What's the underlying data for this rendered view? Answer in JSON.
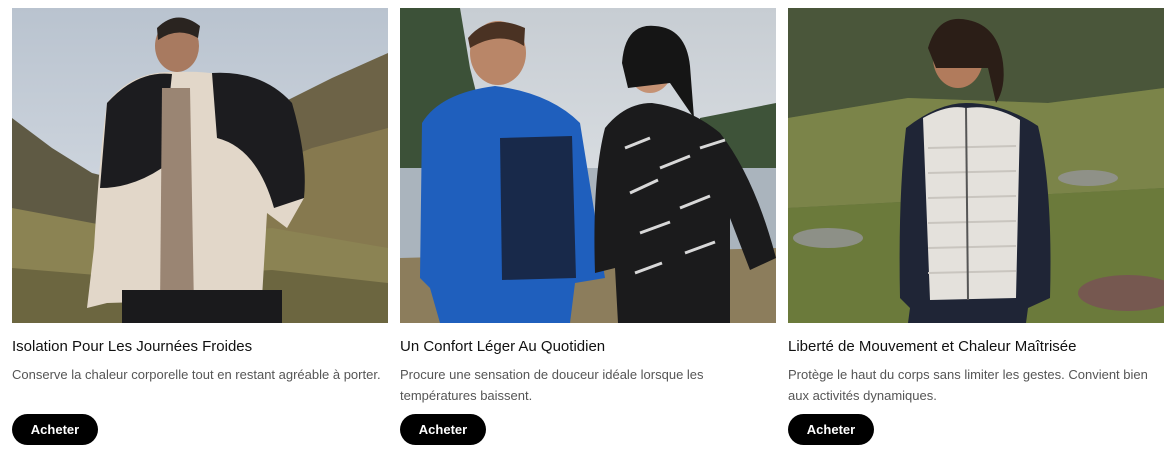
{
  "cards": [
    {
      "title": "Isolation Pour Les Journées Froides",
      "description": "Conserve la chaleur corporelle tout en restant agréable à porter.",
      "button_label": "Acheter"
    },
    {
      "title": "Un Confort Léger Au Quotidien",
      "description": "Procure une sensation de douceur idéale lorsque les températures baissent.",
      "button_label": "Acheter"
    },
    {
      "title": "Liberté de Mouvement et Chaleur Maîtrisée",
      "description": "Protège le haut du corps sans limiter les gestes. Convient bien aux activités dynamiques.",
      "button_label": "Acheter"
    }
  ]
}
